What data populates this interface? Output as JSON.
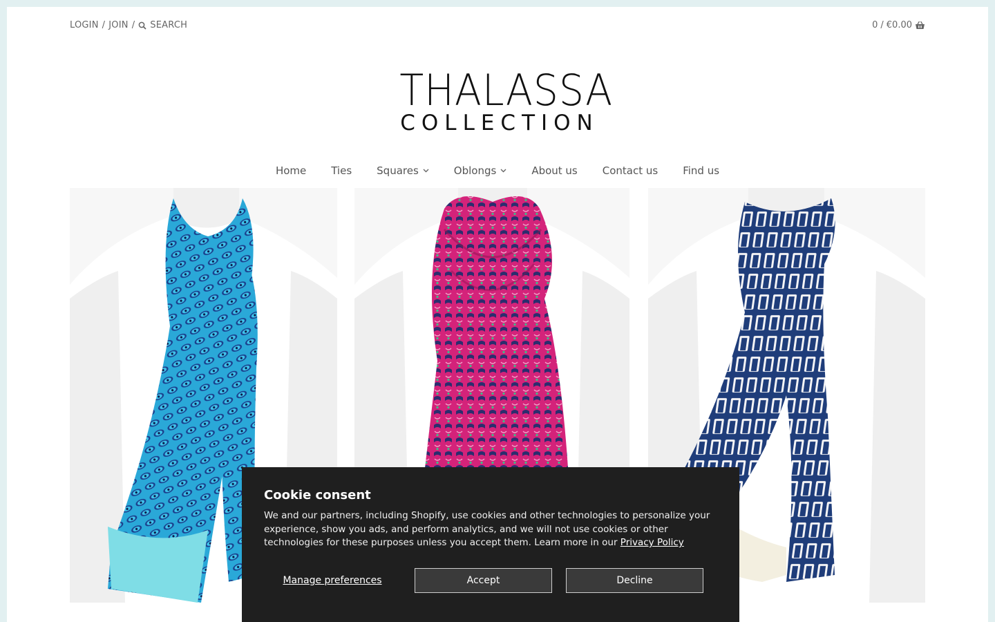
{
  "topbar": {
    "login": "LOGIN",
    "sep1": "/",
    "join": "JOIN",
    "sep2": "/",
    "search_label": "SEARCH",
    "search_icon": "search-icon"
  },
  "cart": {
    "count": "0",
    "sep": "/",
    "total": "€0.00",
    "icon": "basket-icon"
  },
  "logo": {
    "line1": "THALASSA",
    "line2": "COLLECTION"
  },
  "nav": {
    "items": [
      {
        "label": "Home",
        "has_dropdown": false
      },
      {
        "label": "Ties",
        "has_dropdown": false
      },
      {
        "label": "Squares",
        "has_dropdown": true
      },
      {
        "label": "Oblongs",
        "has_dropdown": true
      },
      {
        "label": "About us",
        "has_dropdown": false
      },
      {
        "label": "Contact us",
        "has_dropdown": false
      },
      {
        "label": "Find us",
        "has_dropdown": false
      }
    ]
  },
  "products": [
    {
      "scarf_color": "#2aa8d8",
      "accent": "#1b3f8c",
      "border": "#7fdde6"
    },
    {
      "scarf_color": "#d4237a",
      "accent": "#2c2d6e",
      "border": "#d4237a"
    },
    {
      "scarf_color": "#1f3d7a",
      "accent": "#ffffff",
      "border": "#f3efe0"
    }
  ],
  "cookie": {
    "title": "Cookie consent",
    "body": "We and our partners, including Shopify, use cookies and other technologies to personalize your experience, show you ads, and perform analytics, and we will not use cookies or other technologies for these purposes unless you accept them. Learn more in our ",
    "privacy_link": "Privacy Policy",
    "manage": "Manage preferences",
    "accept": "Accept",
    "decline": "Decline"
  },
  "colors": {
    "background": "#e2f0f1",
    "cookie_bg": "#1f1f1f"
  }
}
